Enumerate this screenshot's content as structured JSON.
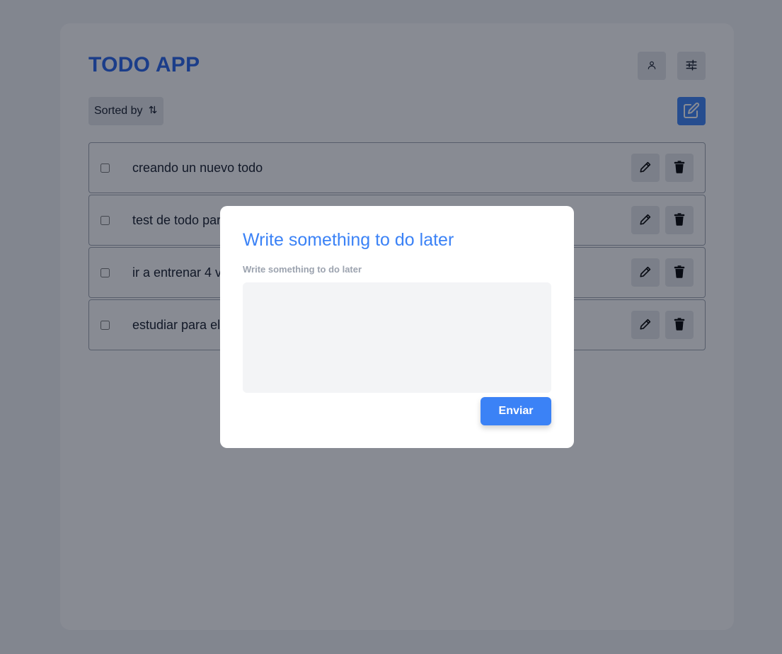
{
  "colors": {
    "title": "#2563eb",
    "accent": "#3b82f6",
    "modal_title": "#3b82f6"
  },
  "header": {
    "title": "TODO APP",
    "user_icon": "user-icon",
    "settings_icon": "sliders-icon"
  },
  "toolbar": {
    "sort_label": "Sorted by",
    "sort_icon": "sort-arrows-icon",
    "new_icon": "edit-square-icon"
  },
  "todos": [
    {
      "text": "creando un nuevo todo",
      "checked": false
    },
    {
      "text": "test de todo par",
      "checked": false
    },
    {
      "text": "ir a entrenar 4 v",
      "checked": false
    },
    {
      "text": "estudiar para el",
      "checked": false
    }
  ],
  "row_icons": {
    "edit": "pencil-icon",
    "delete": "trash-icon"
  },
  "modal": {
    "title": "Write something to do later",
    "label": "Write something to do later",
    "textarea_value": "",
    "submit_label": "Enviar"
  }
}
